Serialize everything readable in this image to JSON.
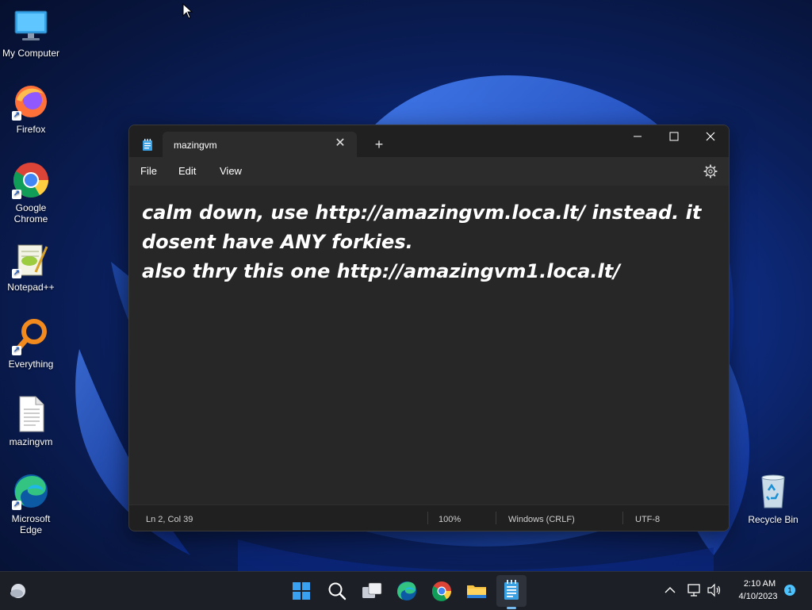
{
  "desktop": {
    "icons": [
      {
        "label": "My Computer",
        "icon": "monitor-icon"
      },
      {
        "label": "Firefox",
        "icon": "firefox-icon"
      },
      {
        "label": "Google Chrome",
        "icon": "chrome-icon"
      },
      {
        "label": "Notepad++",
        "icon": "notepadpp-icon"
      },
      {
        "label": "Everything",
        "icon": "everything-search-icon"
      },
      {
        "label": "mazingvm",
        "icon": "text-file-icon"
      },
      {
        "label": "Microsoft Edge",
        "icon": "edge-icon"
      }
    ],
    "recycle_bin": {
      "label": "Recycle Bin",
      "icon": "recycle-bin-icon"
    }
  },
  "notepad": {
    "tab_title": "mazingvm",
    "tab_close": "✕",
    "new_tab": "+",
    "window_buttons": {
      "minimize": "—",
      "maximize": "☐",
      "close": "✕"
    },
    "menu": {
      "file": "File",
      "edit": "Edit",
      "view": "View"
    },
    "content": "calm down, use http://amazingvm.loca.lt/ instead. it dosent have ANY forkies.\nalso thry this one http://amazingvm1.loca.lt/",
    "status": {
      "position": "Ln 2, Col 39",
      "zoom": "100%",
      "line_ending": "Windows (CRLF)",
      "encoding": "UTF-8"
    }
  },
  "taskbar": {
    "apps": [
      "start-icon",
      "search-icon",
      "task-view-icon",
      "edge-icon",
      "chrome-icon",
      "file-explorer-icon",
      "notepad-icon"
    ],
    "clock": {
      "time": "2:10 AM",
      "date": "4/10/2023"
    },
    "notifications": "1"
  },
  "colors": {
    "accent": "#76b9ed",
    "window_bg": "#202020",
    "editor_bg": "#272727",
    "taskbar_bg": "#1c1f26"
  }
}
